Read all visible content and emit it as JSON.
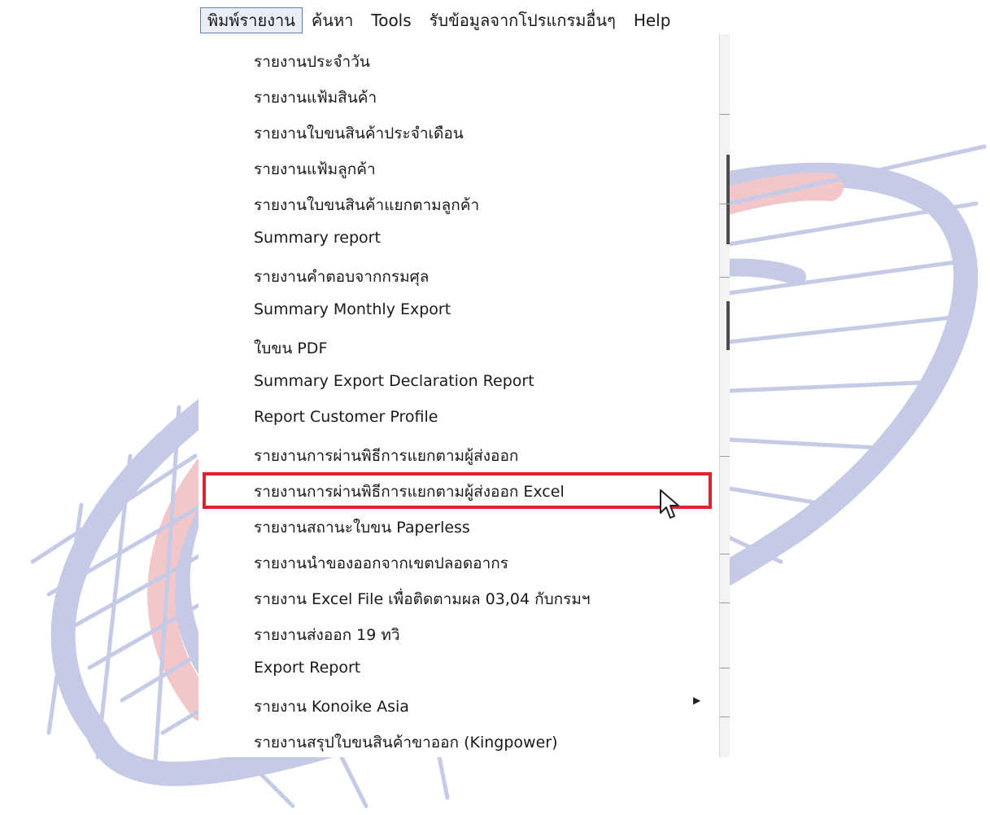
{
  "menubar": {
    "items": [
      {
        "label": "พิมพ์รายงาน",
        "active": true
      },
      {
        "label": "ค้นหา"
      },
      {
        "label": "Tools"
      },
      {
        "label": "รับข้อมูลจากโปรแกรมอื่นๆ"
      },
      {
        "label": "Help"
      }
    ]
  },
  "dropdown": {
    "items": [
      {
        "label": "รายงานประจำวัน"
      },
      {
        "label": "รายงานแฟ้มสินค้า"
      },
      {
        "label": "รายงานใบขนสินค้าประจำเดือน"
      },
      {
        "label": "รายงานแฟ้มลูกค้า"
      },
      {
        "label": "รายงานใบขนสินค้าแยกตามลูกค้า"
      },
      {
        "label": "Summary report"
      },
      {
        "label": "รายงานคำตอบจากกรมศุล"
      },
      {
        "label": "Summary Monthly Export"
      },
      {
        "label": "ใบขน PDF"
      },
      {
        "label": "Summary Export Declaration Report"
      },
      {
        "label": "Report Customer Profile"
      },
      {
        "label": "รายงานการผ่านพิธีการแยกตามผู้ส่งออก"
      },
      {
        "label": "รายงานการผ่านพิธีการแยกตามผู้ส่งออก Excel",
        "highlighted": true
      },
      {
        "label": "รายงานสถานะใบขน Paperless"
      },
      {
        "label": "รายงานนำของออกจากเขตปลอดอากร"
      },
      {
        "label": "รายงาน Excel File เพื่อติดตามผล 03,04 กับกรมฯ"
      },
      {
        "label": "รายงานส่งออก 19 ทวิ"
      },
      {
        "label": "Export Report"
      },
      {
        "label": "รายงาน Konoike Asia",
        "has_submenu": true
      },
      {
        "label": "รายงานสรุปใบขนสินค้าขาออก (Kingpower)"
      }
    ],
    "submenu_arrow": "▶"
  },
  "colors": {
    "highlight_border": "#e2202f",
    "watermark_blue": "#c5cbe7",
    "watermark_red": "#f3c7c9"
  },
  "icons": {
    "cursor": "arrow-cursor-icon",
    "submenu": "chevron-right-icon"
  }
}
